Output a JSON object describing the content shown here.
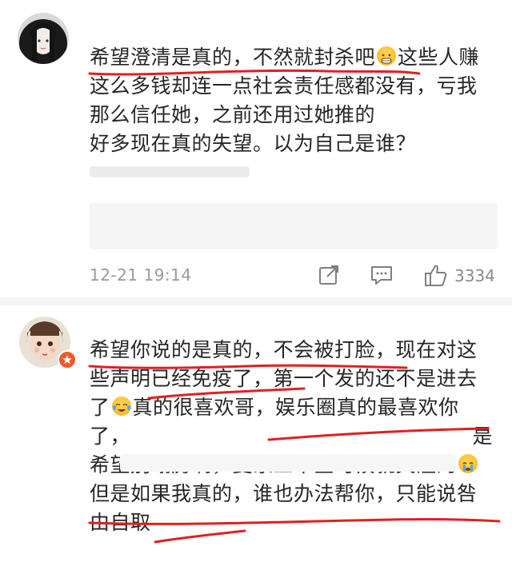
{
  "comments": [
    {
      "lines": [
        "希望澄清是真的，不然就封杀吧",
        "这么多钱却连一点社会责任感都没有，亏我",
        "那么信任她，之前还用过她推的",
        "好多现在真的失望。以为自己是谁？"
      ],
      "line1_after_emoji": "这些人赚",
      "emoji": "grinning-emoji",
      "timestamp": "12-21 19:14",
      "like_count": "3334"
    },
    {
      "lines": [
        "希望你说的是真的，不会被打脸，现在对这",
        "些声明已经免疫了，第一个发的还不是进去",
        "了",
        "了，",
        "希望别塌房啊，夏家三千金时候就关注的",
        "但是如果我真的，谁也办法帮你，只能说咎",
        "由自取"
      ],
      "line3_after_emoji": "真的很喜欢哥，娱乐圈真的最喜欢你",
      "line4_end": "是",
      "emoji": "crying-laughing-emoji",
      "emoji_line5": "crying-emoji",
      "badge": "verified-badge"
    }
  ],
  "icons": {
    "share": "share-icon",
    "comment": "comment-icon",
    "like": "thumbs-up-icon"
  },
  "colors": {
    "underline": "#e02020",
    "timestamp": "#9a9a9a",
    "text": "#262626"
  }
}
